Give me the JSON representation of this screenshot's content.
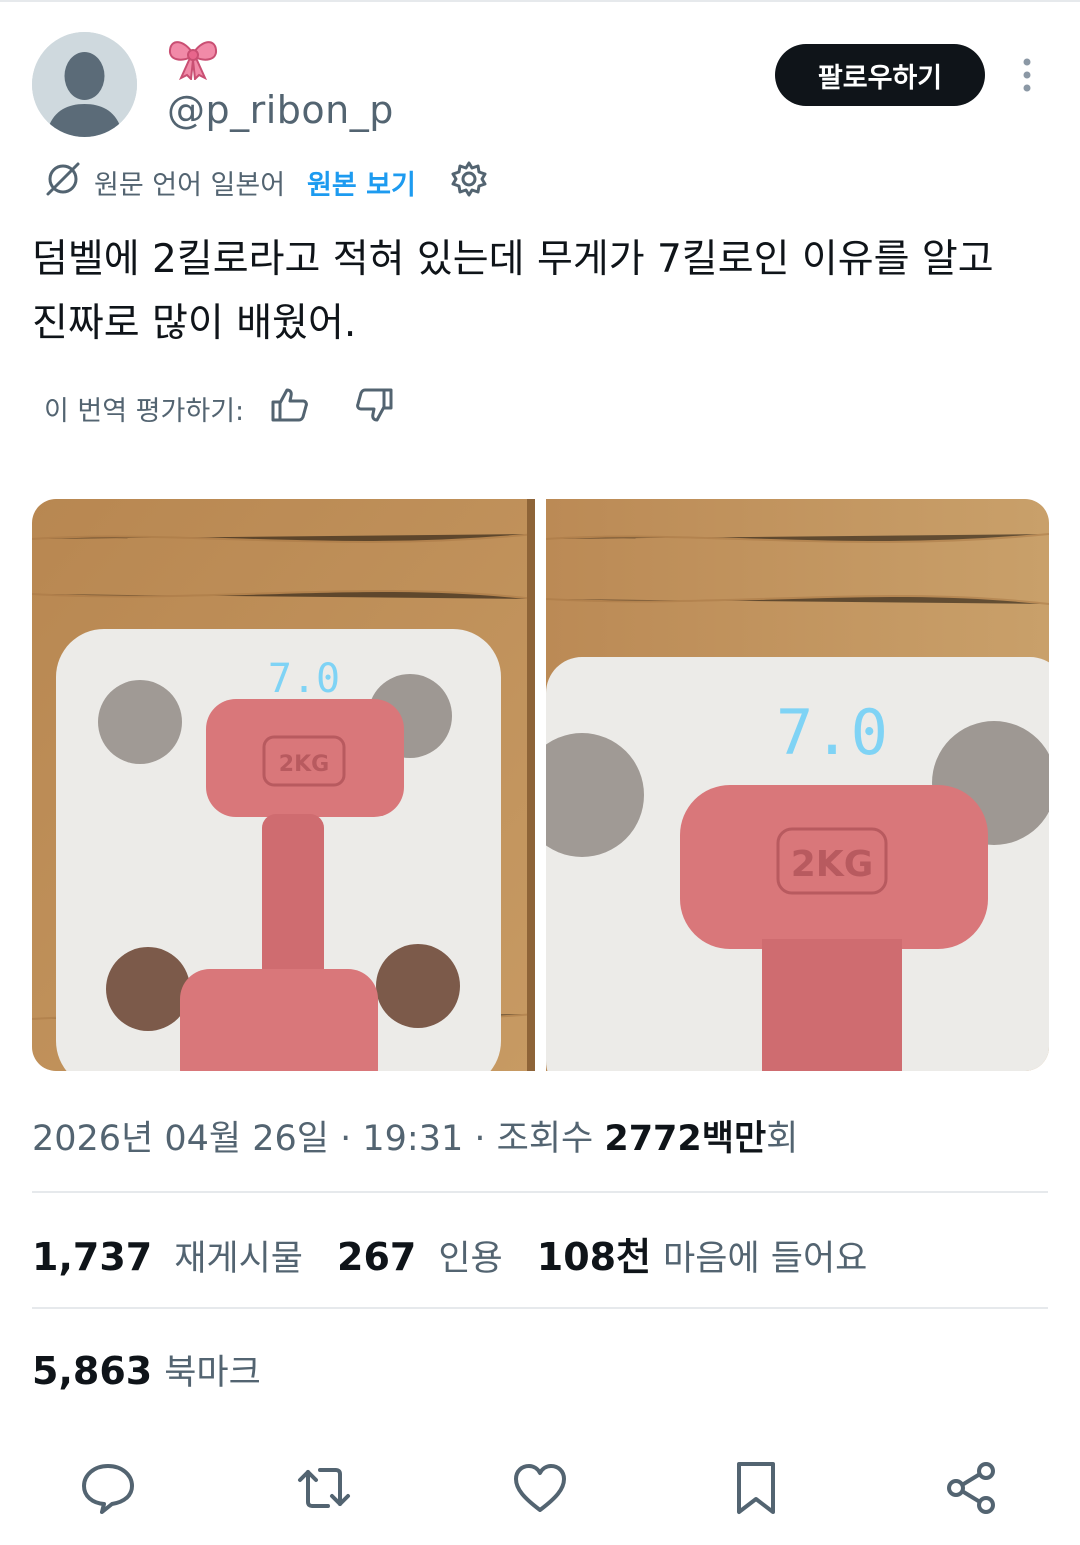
{
  "user": {
    "emoji": "🎀",
    "handle": "@p_ribon_p"
  },
  "follow_button": {
    "label": "팔로우하기"
  },
  "translation": {
    "source_label": "원문 언어 일본어",
    "view_original": "원본 보기"
  },
  "post": {
    "text_line1": "덤벨에 2킬로라고 적혀 있는데 무게가 7킬로인 이유를 알고",
    "text_line2": "진짜로 많이 배웠어."
  },
  "rating": {
    "label": "이 번역 평가하기:"
  },
  "photos": {
    "left": {
      "display": "7.0",
      "dumbbell_label": "2KG"
    },
    "right": {
      "display": "7.0",
      "dumbbell_label": "2KG"
    }
  },
  "meta": {
    "date": "2026년 04월 26일 · 19:31 · 조회수 ",
    "views": "2772백만",
    "views_suffix": "회"
  },
  "stats": {
    "reposts_count": "1,737",
    "reposts_label": "재게시물",
    "quotes_count": "267",
    "quotes_label": "인용",
    "likes_count": "108천",
    "likes_label": "마음에 들어요"
  },
  "bookmarks": {
    "count": "5,863",
    "label": "북마크"
  },
  "colors": {
    "link_blue": "#1d9bf0",
    "text_primary": "#0f1419",
    "text_secondary": "#536471",
    "dumbbell_pink": "#d9777a",
    "display_blue": "#7fd3f5"
  },
  "icons": [
    "more-icon",
    "translate-icon",
    "gear-icon",
    "thumbs-up-icon",
    "thumbs-down-icon",
    "reply-icon",
    "repost-icon",
    "like-icon",
    "bookmark-icon",
    "share-icon"
  ]
}
